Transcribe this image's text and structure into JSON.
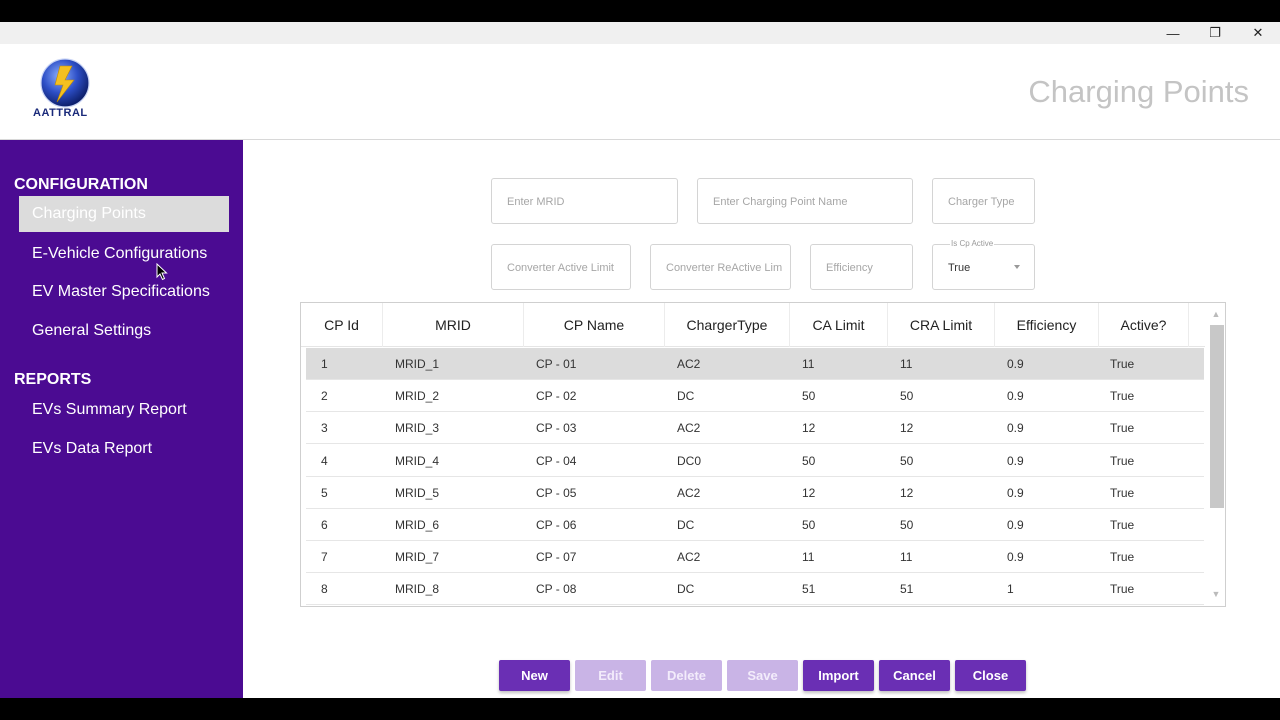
{
  "window": {
    "minimize_icon": "minimize-icon",
    "restore_icon": "restore-icon",
    "close_icon": "close-icon",
    "minimize_glyph": "—",
    "restore_glyph": "❐",
    "close_glyph": "✕"
  },
  "header": {
    "logo_text": "AATTRAL",
    "page_title": "Charging Points"
  },
  "sidebar": {
    "configuration_heading": "CONFIGURATION",
    "config_items": [
      {
        "label": "Charging Points",
        "active": true
      },
      {
        "label": "E-Vehicle Configurations",
        "active": false
      },
      {
        "label": "EV Master Specifications",
        "active": false
      },
      {
        "label": "General Settings",
        "active": false
      }
    ],
    "reports_heading": "REPORTS",
    "report_items": [
      {
        "label": "EVs Summary Report"
      },
      {
        "label": "EVs Data Report"
      }
    ]
  },
  "form": {
    "mrid_placeholder": "Enter MRID",
    "cp_name_placeholder": "Enter Charging Point Name",
    "charger_type_placeholder": "Charger Type",
    "converter_active_placeholder": "Converter Active Limit",
    "converter_reactive_placeholder": "Converter ReActive Lim",
    "efficiency_placeholder": "Efficiency",
    "is_cp_active_label": "Is Cp Active",
    "is_cp_active_value": "True"
  },
  "table": {
    "columns": [
      "CP Id",
      "MRID",
      "CP Name",
      "ChargerType",
      "CA Limit",
      "CRA Limit",
      "Efficiency",
      "Active?"
    ],
    "rows": [
      [
        "1",
        "MRID_1",
        "CP - 01",
        "AC2",
        "11",
        "11",
        "0.9",
        "True"
      ],
      [
        "2",
        "MRID_2",
        "CP - 02",
        "DC",
        "50",
        "50",
        "0.9",
        "True"
      ],
      [
        "3",
        "MRID_3",
        "CP - 03",
        "AC2",
        "12",
        "12",
        "0.9",
        "True"
      ],
      [
        "4",
        "MRID_4",
        "CP - 04",
        "DC0",
        "50",
        "50",
        "0.9",
        "True"
      ],
      [
        "5",
        "MRID_5",
        "CP - 05",
        "AC2",
        "12",
        "12",
        "0.9",
        "True"
      ],
      [
        "6",
        "MRID_6",
        "CP - 06",
        "DC",
        "50",
        "50",
        "0.9",
        "True"
      ],
      [
        "7",
        "MRID_7",
        "CP - 07",
        "AC2",
        "11",
        "11",
        "0.9",
        "True"
      ],
      [
        "8",
        "MRID_8",
        "CP - 08",
        "DC",
        "51",
        "51",
        "1",
        "True"
      ]
    ],
    "selected_row": 0
  },
  "buttons": {
    "new": "New",
    "edit": "Edit",
    "delete": "Delete",
    "save": "Save",
    "import": "Import",
    "cancel": "Cancel",
    "close": "Close"
  },
  "colors": {
    "sidebar": "#4b0b92",
    "button_primary": "#6a2fb4",
    "button_disabled": "#c9b4e6"
  }
}
